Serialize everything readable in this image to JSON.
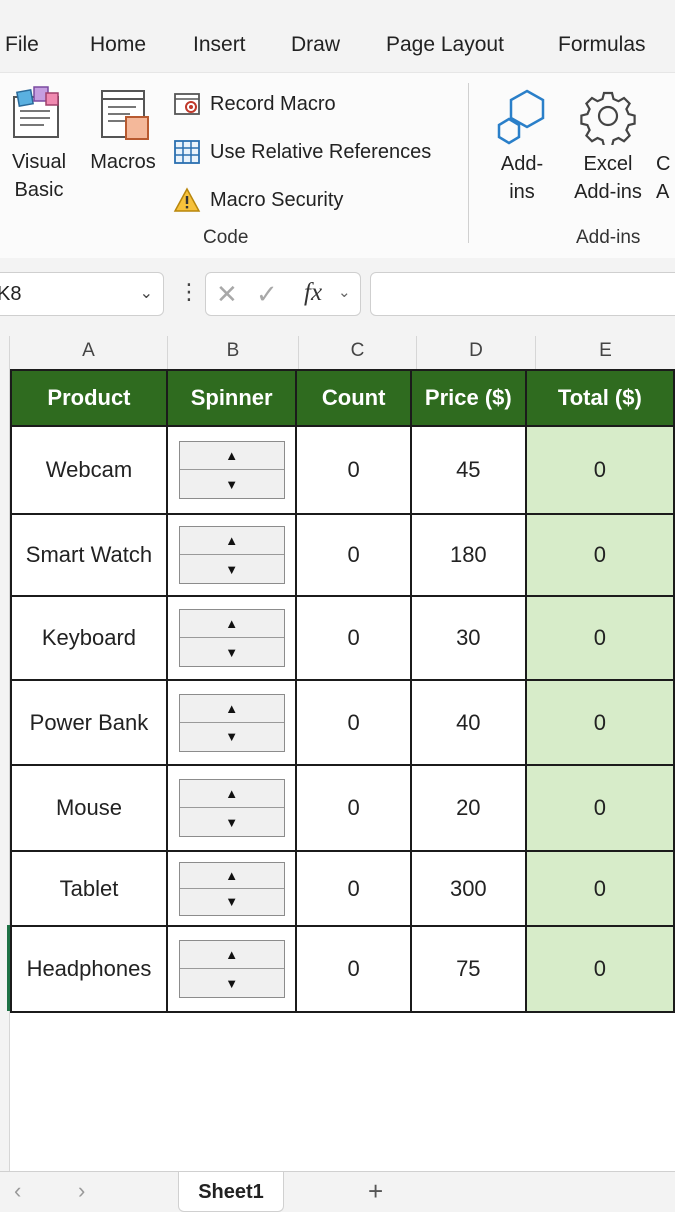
{
  "menu": {
    "tabs": [
      "File",
      "Home",
      "Insert",
      "Draw",
      "Page Layout",
      "Formulas"
    ]
  },
  "ribbon": {
    "code_group": {
      "label": "Code",
      "visual_basic": "Visual Basic",
      "visual_basic_line1": "Visual",
      "visual_basic_line2": "Basic",
      "macros": "Macros",
      "record_macro": "Record Macro",
      "use_relative_references": "Use Relative References",
      "macro_security": "Macro Security"
    },
    "addins_group": {
      "label": "Add-ins",
      "addins_line1": "Add-",
      "addins_line2": "ins",
      "excel_addins_line1": "Excel",
      "excel_addins_line2": "Add-ins",
      "cut_off_line1": "C",
      "cut_off_line2": "A"
    }
  },
  "formula_bar": {
    "name_box_value": "K8",
    "fx_label": "fx",
    "formula_value": ""
  },
  "columns": [
    "A",
    "B",
    "C",
    "D",
    "E"
  ],
  "table": {
    "headers": [
      "Product",
      "Spinner",
      "Count",
      "Price ($)",
      "Total ($)"
    ],
    "rows": [
      {
        "product": "Webcam",
        "count": "0",
        "price": "45",
        "total": "0"
      },
      {
        "product": "Smart Watch",
        "count": "0",
        "price": "180",
        "total": "0"
      },
      {
        "product": "Keyboard",
        "count": "0",
        "price": "30",
        "total": "0"
      },
      {
        "product": "Power Bank",
        "count": "0",
        "price": "40",
        "total": "0"
      },
      {
        "product": "Mouse",
        "count": "0",
        "price": "20",
        "total": "0"
      },
      {
        "product": "Tablet",
        "count": "0",
        "price": "300",
        "total": "0"
      },
      {
        "product": "Headphones",
        "count": "0",
        "price": "75",
        "total": "0"
      }
    ]
  },
  "sheets": {
    "active": "Sheet1",
    "add_label": "+"
  },
  "colors": {
    "header_green": "#2f6b1f",
    "total_fill": "#d7ecc9",
    "accent": "#1e7145"
  }
}
